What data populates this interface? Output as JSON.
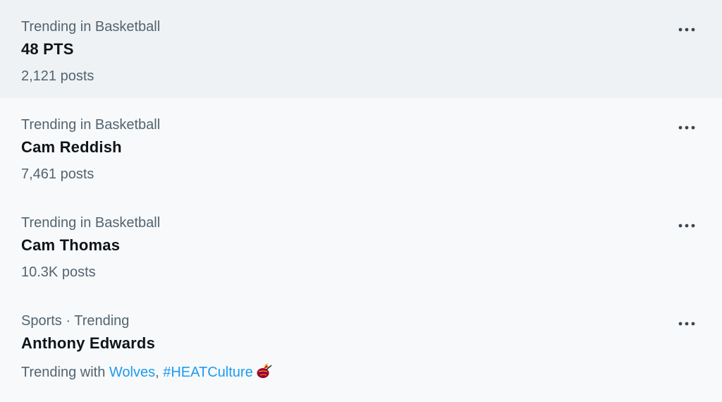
{
  "trends": [
    {
      "context": "Trending in Basketball",
      "title": "48 PTS",
      "meta": "2,121 posts"
    },
    {
      "context": "Trending in Basketball",
      "title": "Cam Reddish",
      "meta": "7,461 posts"
    },
    {
      "context": "Trending in Basketball",
      "title": "Cam Thomas",
      "meta": "10.3K posts"
    },
    {
      "context": "Sports · Trending",
      "title": "Anthony Edwards",
      "meta_prefix": "Trending with",
      "related": [
        "Wolves",
        "#HEATCulture"
      ],
      "separator": ","
    }
  ],
  "icons": {
    "more": "more-horizontal-icon",
    "heat": "heat-logo-icon"
  },
  "colors": {
    "accent": "#1d9bf0",
    "secondary_text": "#536471",
    "primary_text": "#0f1419",
    "hover_bg": "#eff2f4",
    "page_bg": "#f7f9fa"
  }
}
